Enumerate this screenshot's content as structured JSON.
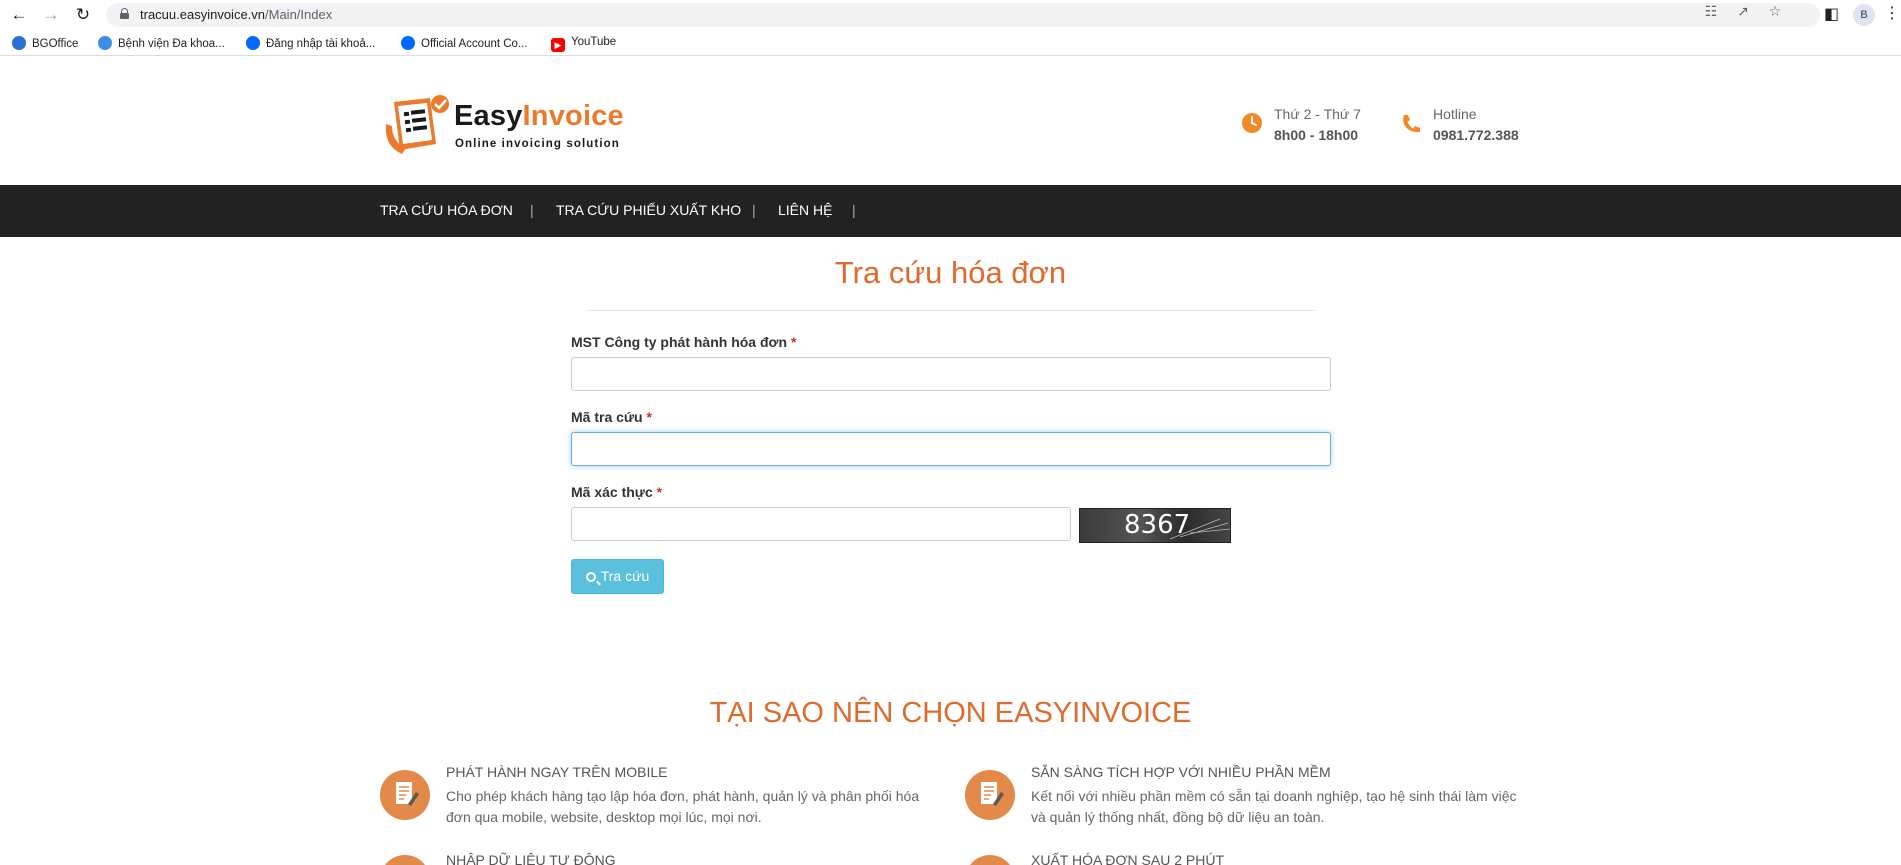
{
  "browser": {
    "url_host": "tracuu.easyinvoice.vn",
    "url_path": "/Main/Index",
    "profile_initial": "B",
    "bookmarks": [
      {
        "label": "BGOffice",
        "icon": "bgoffice-icon",
        "color": "#2a6fd6"
      },
      {
        "label": "Bệnh viện Đa khoa...",
        "icon": "hospital-icon",
        "color": "#3a8ee6"
      },
      {
        "label": "Đăng nhập tài khoả...",
        "icon": "zalo-icon",
        "color": "#0068ff"
      },
      {
        "label": "Official Account Co...",
        "icon": "zalo-oa-icon",
        "color": "#0068ff"
      },
      {
        "label": "YouTube",
        "icon": "youtube-icon",
        "color": "#ff0000"
      }
    ]
  },
  "header": {
    "logo_easy": "Easy",
    "logo_invoice": "Invoice",
    "tagline": "Online invoicing solution",
    "hours_label": "Thứ 2 - Thứ 7",
    "hours_value": "8h00 - 18h00",
    "hotline_label": "Hotline",
    "hotline_value": "0981.772.388"
  },
  "menu": {
    "items": [
      "TRA CỨU HÓA ĐƠN",
      "TRA CỨU PHIẾU XUẤT KHO",
      "LIÊN HỆ"
    ],
    "separator": "|"
  },
  "form": {
    "title": "Tra cứu hóa đơn",
    "mst_label": "MST Công ty phát hành hóa đơn",
    "lookup_label": "Mã tra cứu",
    "captcha_label": "Mã xác thực",
    "required_mark": "*",
    "mst_value": "",
    "lookup_value": "",
    "captcha_value": "",
    "captcha_code": "8367",
    "search_button": "Tra cứu"
  },
  "why": {
    "title": "TẠI SAO NÊN CHỌN EASYINVOICE",
    "features": [
      {
        "title": "PHÁT HÀNH NGAY TRÊN MOBILE",
        "desc": "Cho phép khách hàng tạo lập hóa đơn, phát hành, quản lý và phân phối hóa đơn qua mobile, website, desktop mọi lúc, mọi nơi."
      },
      {
        "title": "SẴN SÀNG TÍCH HỢP VỚI NHIỀU PHẦN MỀM",
        "desc": "Kết nối với nhiều phần mềm có sẵn tại doanh nghiệp, tạo hệ sinh thái làm việc và quản lý thống nhất, đồng bộ dữ liệu an toàn."
      },
      {
        "title": "NHẬP DỮ LIỆU TỰ ĐỘNG",
        "desc": ""
      },
      {
        "title": "XUẤT HÓA ĐƠN SAU 2 PHÚT",
        "desc": ""
      }
    ]
  },
  "colors": {
    "accent": "#e06a2c",
    "menu_bg": "#222222",
    "button": "#5bc0de"
  }
}
